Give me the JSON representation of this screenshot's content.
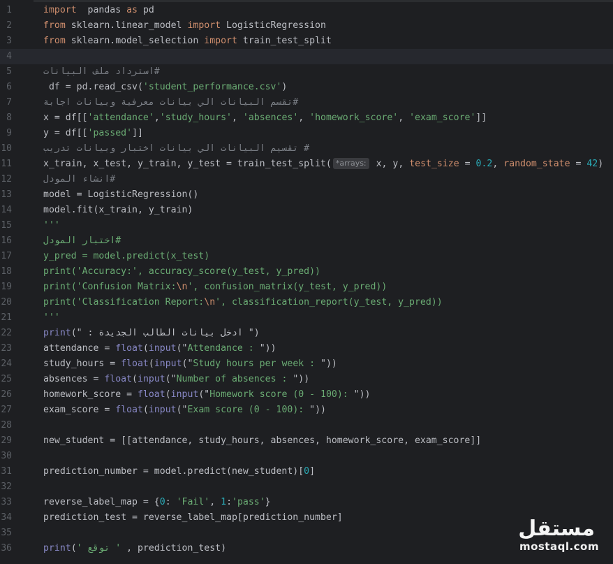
{
  "lines": [
    {
      "n": "1",
      "segs": [
        [
          "kw",
          "import"
        ],
        [
          "",
          "  pandas "
        ],
        [
          "kw",
          "as"
        ],
        [
          "",
          " pd"
        ]
      ]
    },
    {
      "n": "2",
      "segs": [
        [
          "kw",
          "from"
        ],
        [
          "",
          " sklearn.linear_model "
        ],
        [
          "kw",
          "import"
        ],
        [
          "",
          " LogisticRegression"
        ]
      ]
    },
    {
      "n": "3",
      "segs": [
        [
          "kw",
          "from"
        ],
        [
          "",
          " sklearn.model_selection "
        ],
        [
          "kw",
          "import"
        ],
        [
          "",
          " train_test_split"
        ]
      ]
    },
    {
      "n": "4",
      "segs": []
    },
    {
      "n": "5",
      "segs": [
        [
          "cmt",
          "#استرداد ملف البيانات"
        ]
      ]
    },
    {
      "n": "6",
      "segs": [
        [
          "",
          " df = pd.read_csv("
        ],
        [
          "str",
          "'student_performance.csv'"
        ],
        [
          "",
          ")"
        ]
      ]
    },
    {
      "n": "7",
      "segs": [
        [
          "cmt",
          "#تقسم البيانات الي بيانات معرفية وبيانات اجابة"
        ]
      ]
    },
    {
      "n": "8",
      "segs": [
        [
          "",
          "x = df[["
        ],
        [
          "str",
          "'attendance'"
        ],
        [
          "",
          ","
        ],
        [
          "str",
          "'study_hours'"
        ],
        [
          "",
          ", "
        ],
        [
          "str",
          "'absences'"
        ],
        [
          "",
          ", "
        ],
        [
          "str",
          "'homework_score'"
        ],
        [
          "",
          ", "
        ],
        [
          "str",
          "'exam_score'"
        ],
        [
          "",
          "]]"
        ]
      ]
    },
    {
      "n": "9",
      "segs": [
        [
          "",
          "y = df[["
        ],
        [
          "str",
          "'passed'"
        ],
        [
          "",
          "]]"
        ]
      ]
    },
    {
      "n": "10",
      "segs": [
        [
          "cmt",
          "# تقسيم البيانات الي بيانات اختبار وبيانات تدريب"
        ]
      ]
    },
    {
      "n": "11",
      "segs": [
        [
          "",
          "x_train, x_test, y_train, y_test = train_test_split("
        ],
        [
          "hint",
          "*arrays:"
        ],
        [
          "",
          " x, y, "
        ],
        [
          "param",
          "test_size"
        ],
        [
          "",
          " = "
        ],
        [
          "num",
          "0.2"
        ],
        [
          "",
          ", "
        ],
        [
          "param",
          "random_state"
        ],
        [
          "",
          " = "
        ],
        [
          "num",
          "42"
        ],
        [
          "",
          ")"
        ]
      ]
    },
    {
      "n": "12",
      "segs": [
        [
          "cmt",
          "#انشاء المودل"
        ]
      ]
    },
    {
      "n": "13",
      "segs": [
        [
          "",
          "model = LogisticRegression()"
        ]
      ]
    },
    {
      "n": "14",
      "segs": [
        [
          "",
          "model.fit(x_train, y_train)"
        ]
      ]
    },
    {
      "n": "15",
      "segs": [
        [
          "green",
          "'''"
        ]
      ]
    },
    {
      "n": "16",
      "segs": [
        [
          "green",
          "#اختبار المودل"
        ]
      ]
    },
    {
      "n": "17",
      "segs": [
        [
          "green",
          "y_pred = model.predict(x_test)"
        ]
      ]
    },
    {
      "n": "18",
      "segs": [
        [
          "green",
          "print('Accuracy:', accuracy_score(y_test, y_pred))"
        ]
      ]
    },
    {
      "n": "19",
      "segs": [
        [
          "green",
          "print('Confusion Matrix:"
        ],
        [
          "esc",
          "\\n"
        ],
        [
          "green",
          "', confusion_matrix(y_test, y_pred))"
        ]
      ]
    },
    {
      "n": "20",
      "segs": [
        [
          "green",
          "print('Classification Report:"
        ],
        [
          "esc",
          "\\n"
        ],
        [
          "green",
          "', classification_report(y_test, y_pred))"
        ]
      ]
    },
    {
      "n": "21",
      "segs": [
        [
          "green",
          "'''"
        ]
      ]
    },
    {
      "n": "22",
      "segs": [
        [
          "bi",
          "print"
        ],
        [
          "",
          "(\" : ادخل بيانات الطالب الجديدة \")"
        ]
      ]
    },
    {
      "n": "23",
      "segs": [
        [
          "",
          "attendance = "
        ],
        [
          "bi",
          "float"
        ],
        [
          "",
          "("
        ],
        [
          "bi",
          "input"
        ],
        [
          "",
          "(\""
        ],
        [
          "str",
          "Attendance : "
        ],
        [
          "",
          "\"))"
        ]
      ]
    },
    {
      "n": "24",
      "segs": [
        [
          "",
          "study_hours = "
        ],
        [
          "bi",
          "float"
        ],
        [
          "",
          "("
        ],
        [
          "bi",
          "input"
        ],
        [
          "",
          "(\""
        ],
        [
          "str",
          "Study hours per week : "
        ],
        [
          "",
          "\"))"
        ]
      ]
    },
    {
      "n": "25",
      "segs": [
        [
          "",
          "absences = "
        ],
        [
          "bi",
          "float"
        ],
        [
          "",
          "("
        ],
        [
          "bi",
          "input"
        ],
        [
          "",
          "(\""
        ],
        [
          "str",
          "Number of absences : "
        ],
        [
          "",
          "\"))"
        ]
      ]
    },
    {
      "n": "26",
      "segs": [
        [
          "",
          "homework_score = "
        ],
        [
          "bi",
          "float"
        ],
        [
          "",
          "("
        ],
        [
          "bi",
          "input"
        ],
        [
          "",
          "(\""
        ],
        [
          "str",
          "Homework score (0 - 100): "
        ],
        [
          "",
          "\"))"
        ]
      ]
    },
    {
      "n": "27",
      "segs": [
        [
          "",
          "exam_score = "
        ],
        [
          "bi",
          "float"
        ],
        [
          "",
          "("
        ],
        [
          "bi",
          "input"
        ],
        [
          "",
          "(\""
        ],
        [
          "str",
          "Exam score (0 - 100): "
        ],
        [
          "",
          "\"))"
        ]
      ]
    },
    {
      "n": "28",
      "segs": []
    },
    {
      "n": "29",
      "segs": [
        [
          "",
          "new_student = [[attendance, study_hours, absences, homework_score, exam_score]]"
        ]
      ]
    },
    {
      "n": "30",
      "segs": []
    },
    {
      "n": "31",
      "segs": [
        [
          "",
          "prediction_number = model.predict(new_student)["
        ],
        [
          "num",
          "0"
        ],
        [
          "",
          "]"
        ]
      ]
    },
    {
      "n": "32",
      "segs": []
    },
    {
      "n": "33",
      "segs": [
        [
          "",
          "reverse_label_map = {"
        ],
        [
          "num",
          "0"
        ],
        [
          "",
          ": "
        ],
        [
          "str",
          "'Fail'"
        ],
        [
          "",
          ", "
        ],
        [
          "num",
          "1"
        ],
        [
          "",
          ":"
        ],
        [
          "str",
          "'pass'"
        ],
        [
          "",
          "}"
        ]
      ]
    },
    {
      "n": "34",
      "segs": [
        [
          "",
          "prediction_test = reverse_label_map[prediction_number]"
        ]
      ]
    },
    {
      "n": "35",
      "segs": []
    },
    {
      "n": "36",
      "segs": [
        [
          "bi",
          "print"
        ],
        [
          "",
          "("
        ],
        [
          "str",
          "' توقع '"
        ],
        [
          "",
          " , prediction_test)"
        ]
      ]
    }
  ],
  "watermark": {
    "logo": "مستقل",
    "text": "mostaql.com"
  },
  "colors": {
    "background": "#1e1f22",
    "keyword": "#cf8e6d",
    "string": "#6aab73",
    "number": "#2aacb8",
    "comment": "#7a7e85",
    "builtin": "#8888c6"
  }
}
